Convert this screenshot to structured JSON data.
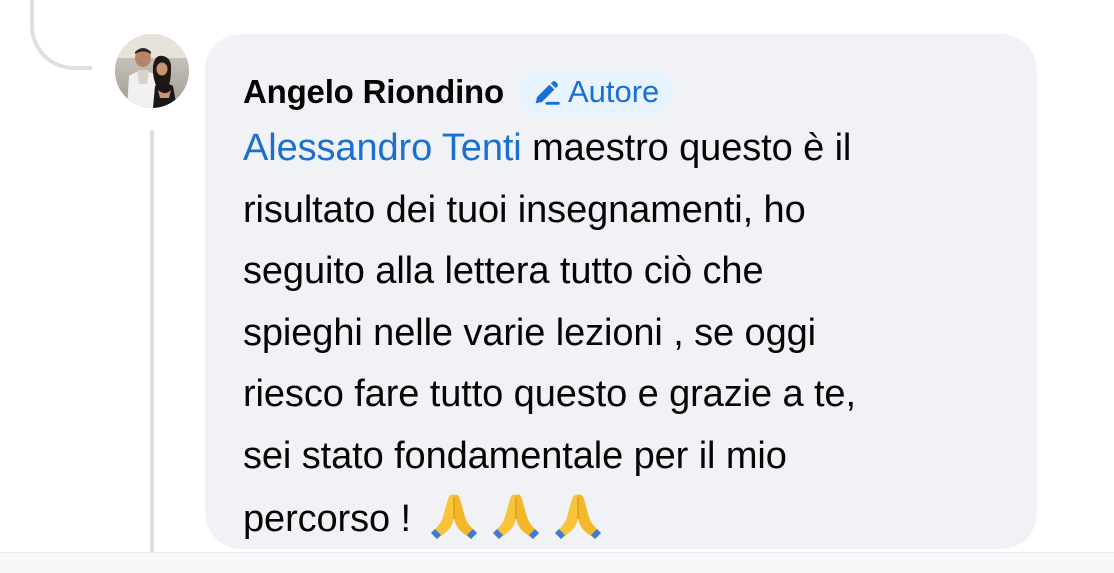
{
  "comment": {
    "author": "Angelo Riondino",
    "badge_label": "Autore",
    "badge_icon": "pencil-icon",
    "mention": "Alessandro Tenti",
    "body_lines": [
      " maestro questo è il",
      "risultato dei tuoi insegnamenti, ho",
      "seguito alla lettera tutto ciò che",
      "spieghi nelle varie lezioni , se oggi",
      "riesco fare tutto questo e grazie a te,",
      "sei stato fondamentale per il mio",
      "percorso ! "
    ],
    "emojis": [
      "🙏",
      "🙏",
      "🙏"
    ],
    "emoji_icon": "folded-hands-icon"
  },
  "colors": {
    "bubble_background": "#f0f2f5",
    "mention": "#1b6fd1",
    "badge_background": "#e7f3ff",
    "thread_line": "#dde0e5"
  }
}
